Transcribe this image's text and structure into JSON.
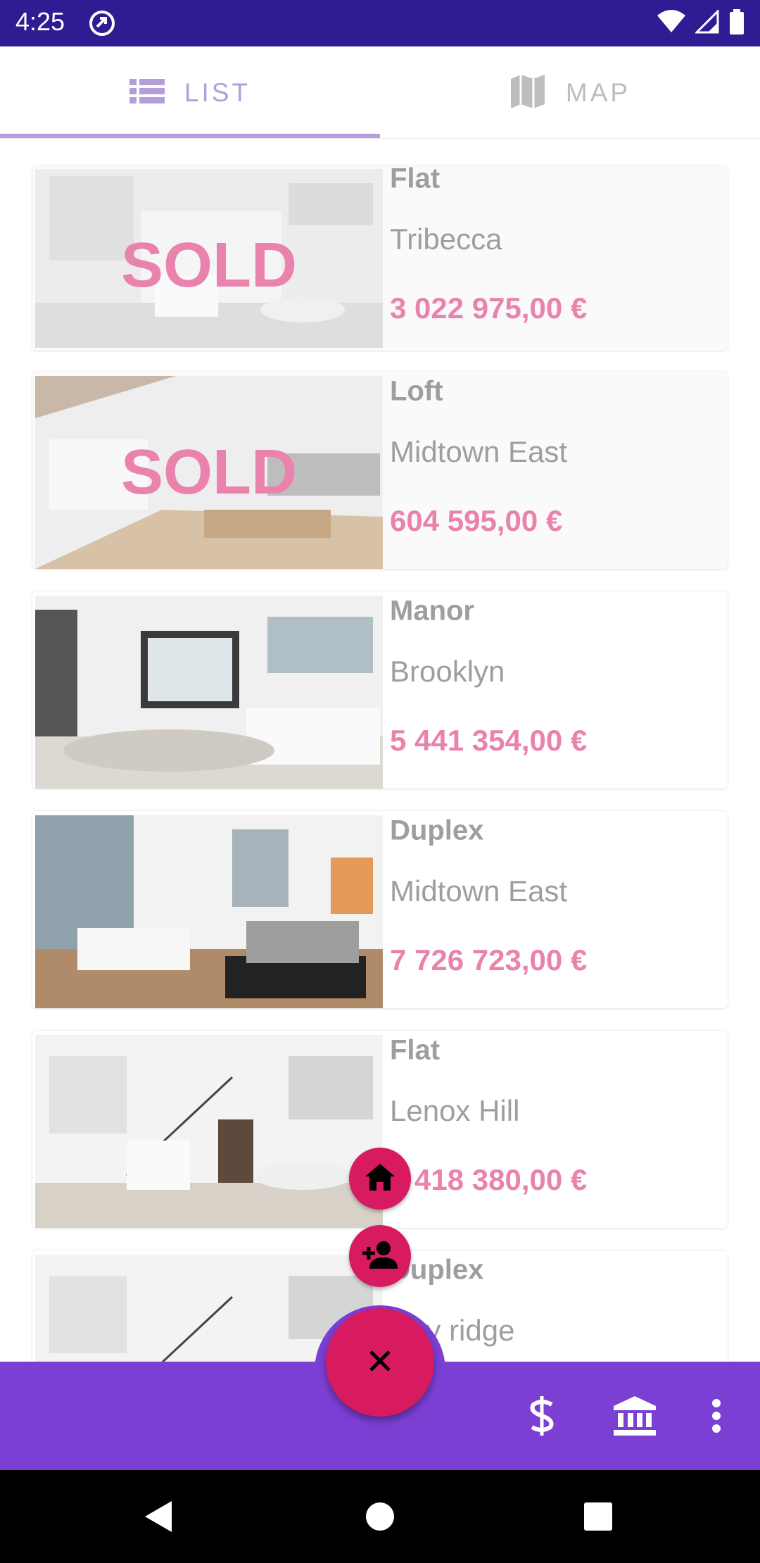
{
  "status_bar": {
    "time": "4:25",
    "icons": [
      "app-notification-icon",
      "wifi-icon",
      "signal-icon",
      "battery-icon"
    ]
  },
  "tabs": [
    {
      "label": "LIST",
      "icon": "list-icon",
      "selected": true
    },
    {
      "label": "MAP",
      "icon": "map-icon",
      "selected": false
    }
  ],
  "listings": [
    {
      "type": "Flat",
      "area": "Tribecca",
      "price": "3 022 975,00 €",
      "sold": true,
      "sold_label": "SOLD"
    },
    {
      "type": "Loft",
      "area": "Midtown East",
      "price": "604 595,00 €",
      "sold": true,
      "sold_label": "SOLD"
    },
    {
      "type": "Manor",
      "area": "Brooklyn",
      "price": "5 441 354,00 €",
      "sold": false
    },
    {
      "type": "Duplex",
      "area": "Midtown East",
      "price": "7 726 723,00 €",
      "sold": false
    },
    {
      "type": "Flat",
      "area": "Lenox Hill",
      "price": "1 418 380,00 €",
      "sold": false
    },
    {
      "type": "Duplex",
      "area": "Bay ridge",
      "price": "",
      "sold": false
    }
  ],
  "fab": {
    "main_icon": "close-icon",
    "mini_actions": [
      {
        "icon": "home-icon"
      },
      {
        "icon": "add-person-icon"
      }
    ]
  },
  "bottom_bar": {
    "actions": [
      "dollar-icon",
      "bank-icon",
      "more-vert-icon"
    ]
  },
  "nav_bar": {
    "buttons": [
      "back-icon",
      "home-circle-icon",
      "recents-icon"
    ]
  },
  "colors": {
    "status_bar": "#311b92",
    "tab_accent": "#b39ddb",
    "price": "#e983ad",
    "bottom_bar": "#7b3fd4",
    "fab": "#d81b60"
  }
}
